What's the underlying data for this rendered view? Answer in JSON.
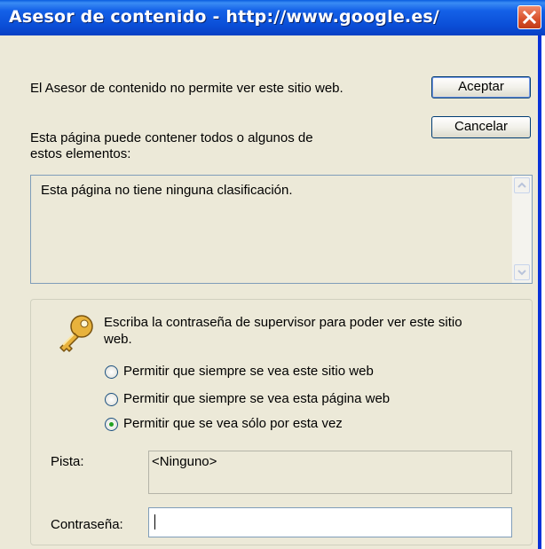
{
  "window": {
    "title": "Asesor de contenido - http://www.google.es/"
  },
  "message": "El Asesor de contenido no permite ver este sitio web.",
  "buttons": {
    "accept": "Aceptar",
    "cancel": "Cancelar"
  },
  "elements_label_1": "Esta página puede contener todos o algunos de",
  "elements_label_2": "estos elementos:",
  "rating_list": {
    "items": [
      "Esta página no tiene ninguna clasificación."
    ]
  },
  "supervisor": {
    "prompt_line1": "Escriba la contraseña de supervisor para poder ver este sitio",
    "prompt_line2": "web.",
    "options": [
      {
        "label": "Permitir que siempre se vea este sitio web",
        "selected": false
      },
      {
        "label": "Permitir que siempre se vea esta página web",
        "selected": false
      },
      {
        "label": "Permitir que se vea sólo por esta vez",
        "selected": true
      }
    ],
    "hint_label": "Pista:",
    "hint_value": "<Ninguno>",
    "password_label": "Contraseña:",
    "password_value": ""
  },
  "icons": {
    "close": "close-icon",
    "key": "key-icon"
  },
  "colors": {
    "titlebar": "#0b4fd8",
    "dialog_bg": "#ece9d8",
    "radio_dot": "#21a121"
  }
}
